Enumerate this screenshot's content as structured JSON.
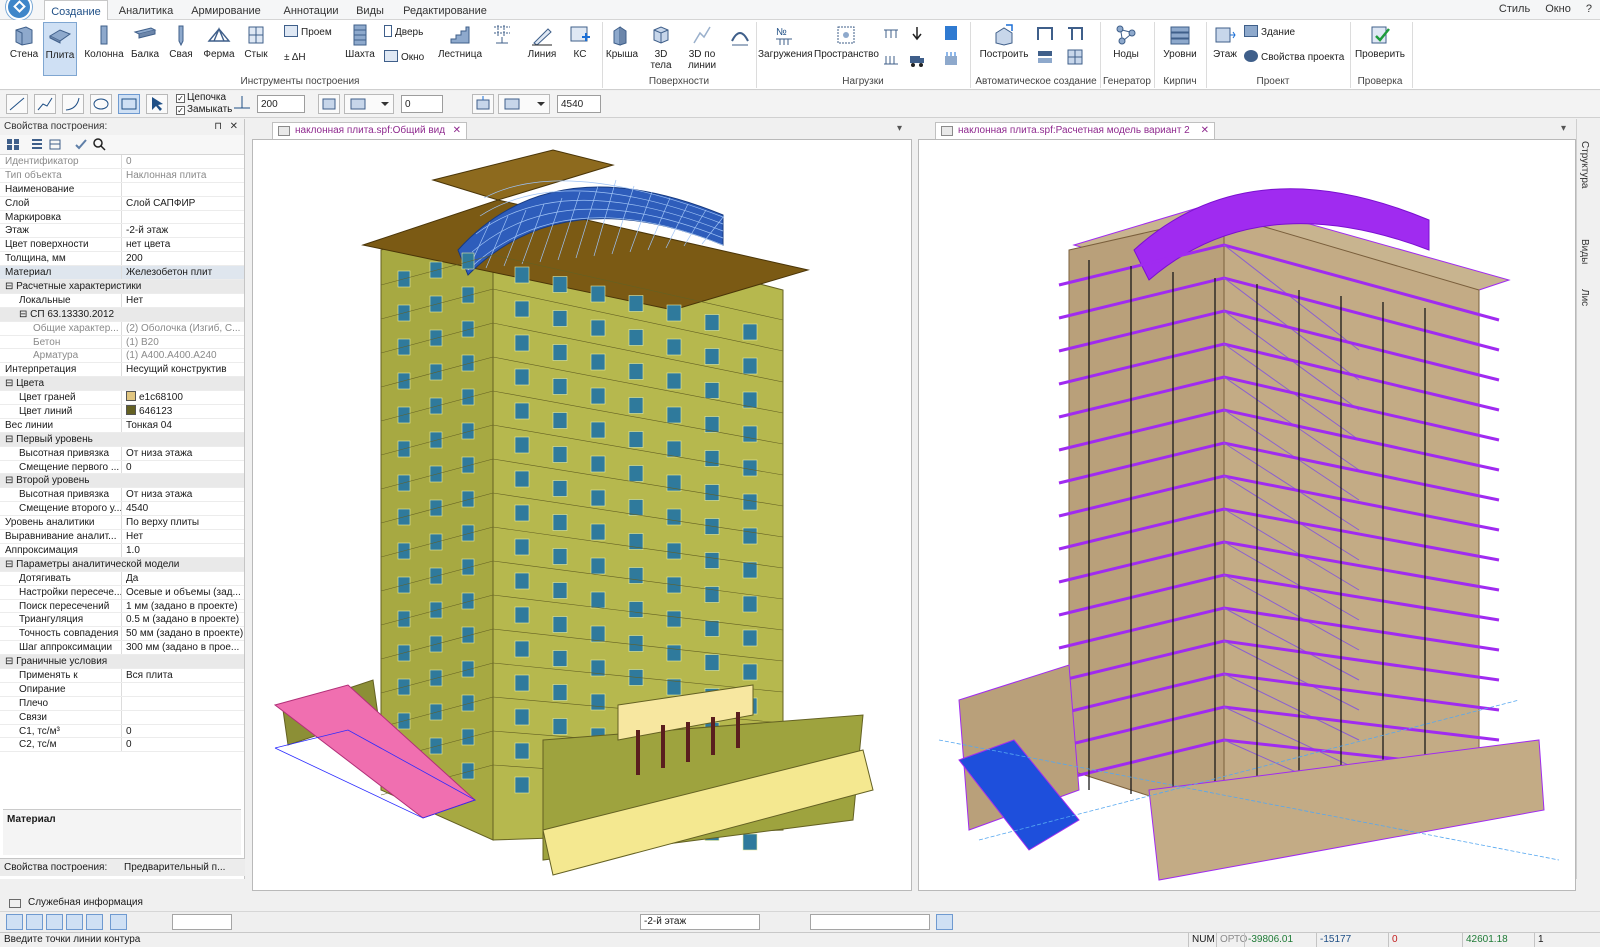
{
  "ribbon": {
    "tabs": [
      "Создание",
      "Аналитика",
      "Армирование",
      "Аннотации",
      "Виды",
      "Редактирование"
    ],
    "active_tab": "Создание",
    "right": {
      "style": "Стиль",
      "window": "Окно",
      "help": "?"
    },
    "build_tools": {
      "group_label": "Инструменты построения",
      "wall": "Стена",
      "slab": "Плита",
      "column": "Колонна",
      "beam": "Балка",
      "pile": "Свая",
      "truss": "Ферма",
      "joint": "Стык",
      "opening": "Проем",
      "delta_h": "± ΔН",
      "shaft": "Шахта",
      "door": "Дверь",
      "window": "Окно",
      "stair": "Лестница",
      "line": "Линия",
      "ks": "КС"
    },
    "surfaces": {
      "group_label": "Поверхности",
      "roof": "Крыша",
      "bodies3d": "3D тела",
      "by_line3d": "3D по линии"
    },
    "loads": {
      "group_label": "Нагрузки",
      "loadings": "Загружения",
      "spaces": "Пространство"
    },
    "auto": {
      "group_label": "Автоматическое создание",
      "build": "Построить"
    },
    "generator": {
      "group_label": "Генератор",
      "nodes": "Ноды"
    },
    "brick": {
      "group_label": "Кирпич",
      "levels": "Уровни"
    },
    "project": {
      "group_label": "Проект",
      "floor": "Этаж",
      "building": "Здание",
      "props": "Свойства проекта"
    },
    "check": {
      "group_label": "Проверка",
      "verify": "Проверить"
    }
  },
  "toolbar2": {
    "chain_label": "Цепочка",
    "close_label": "Замыкать",
    "thickness": "200",
    "offset": "0",
    "level": "4540"
  },
  "props_panel": {
    "title": "Свойства построения:",
    "rows": [
      {
        "k": "Идентификатор",
        "v": "0",
        "cls": "gray"
      },
      {
        "k": "Тип объекта",
        "v": "Наклонная плита",
        "cls": "gray"
      },
      {
        "k": "Наименование",
        "v": ""
      },
      {
        "k": "Слой",
        "v": "Слой САПФИР"
      },
      {
        "k": "Маркировка",
        "v": ""
      },
      {
        "k": "Этаж",
        "v": "-2-й этаж"
      },
      {
        "k": "Цвет поверхности",
        "v": "нет цвета"
      },
      {
        "k": "Толщина, мм",
        "v": "200"
      },
      {
        "k": "Материал",
        "v": "Железобетон плит",
        "cls": "hl"
      },
      {
        "k": "⊟ Расчетные характеристики",
        "v": "",
        "cls": "sec"
      },
      {
        "k": "Локальные",
        "v": "Нет",
        "cls": "lv1"
      },
      {
        "k": "⊟ СП 63.13330.2012",
        "v": "",
        "cls": "sec lv1"
      },
      {
        "k": "Общие характер...",
        "v": "(2) Оболочка (Изгиб, С...",
        "cls": "gray lv2"
      },
      {
        "k": "Бетон",
        "v": "(1) В20",
        "cls": "gray lv2"
      },
      {
        "k": "Арматура",
        "v": "(1) А400.А400.А240",
        "cls": "gray lv2"
      },
      {
        "k": "Интерпретация",
        "v": "Несущий конструктив"
      },
      {
        "k": "⊟ Цвета",
        "v": "",
        "cls": "sec"
      },
      {
        "k": "Цвет граней",
        "v": "e1c68100",
        "cls": "lv1",
        "swatch": "#e1c681"
      },
      {
        "k": "Цвет линий",
        "v": "646123",
        "cls": "lv1",
        "swatch": "#646123"
      },
      {
        "k": "Вес линии",
        "v": "Тонкая 04"
      },
      {
        "k": "⊟ Первый уровень",
        "v": "",
        "cls": "sec"
      },
      {
        "k": "Высотная привязка",
        "v": "От низа этажа",
        "cls": "lv1"
      },
      {
        "k": "Смещение первого ...",
        "v": "0",
        "cls": "lv1"
      },
      {
        "k": "⊟ Второй уровень",
        "v": "",
        "cls": "sec"
      },
      {
        "k": "Высотная привязка",
        "v": "От низа этажа",
        "cls": "lv1"
      },
      {
        "k": "Смещение второго у...",
        "v": "4540",
        "cls": "lv1"
      },
      {
        "k": "Уровень аналитики",
        "v": "По верху плиты"
      },
      {
        "k": "Выравнивание аналит...",
        "v": "Нет"
      },
      {
        "k": "Аппроксимация",
        "v": "1.0"
      },
      {
        "k": "⊟ Параметры аналитической модели",
        "v": "",
        "cls": "sec"
      },
      {
        "k": "Дотягивать",
        "v": "Да",
        "cls": "lv1"
      },
      {
        "k": "Настройки пересече...",
        "v": "Осевые и объемы (зад...",
        "cls": "lv1"
      },
      {
        "k": "Поиск пересечений",
        "v": "1 мм (задано в проекте)",
        "cls": "lv1"
      },
      {
        "k": "Триангуляция",
        "v": "0.5 м (задано в проекте)",
        "cls": "lv1"
      },
      {
        "k": "Точность совпадения",
        "v": "50 мм (задано в проекте)",
        "cls": "lv1"
      },
      {
        "k": "Шаг аппроксимации",
        "v": "300 мм (задано в прое...",
        "cls": "lv1"
      },
      {
        "k": "⊟ Граничные условия",
        "v": "",
        "cls": "sec"
      },
      {
        "k": "Применять к",
        "v": "Вся плита",
        "cls": "lv1"
      },
      {
        "k": "Опирание",
        "v": "",
        "cls": "lv1"
      },
      {
        "k": "Плечо",
        "v": "",
        "cls": "lv1"
      },
      {
        "k": "Связи",
        "v": "",
        "cls": "lv1"
      },
      {
        "k": "С1, тс/м³",
        "v": "0",
        "cls": "lv1"
      },
      {
        "k": "С2, тс/м",
        "v": "0",
        "cls": "lv1"
      }
    ],
    "description_title": "Материал",
    "bottom_tabs": [
      "Свойства построения:",
      "Предварительный п..."
    ]
  },
  "viewports": {
    "left_tab": "наклонная плита.spf:Общий вид",
    "right_tab": "наклонная плита.spf:Расчетная модель вариант 2"
  },
  "dock": [
    "Структура",
    "Виды",
    "Лис"
  ],
  "service_info": "Служебная информация",
  "bottom_toolbar": {
    "floor": "-2-й этаж"
  },
  "statusbar": {
    "message": "Введите точки линии контура",
    "num": "NUM",
    "orto": "ОРТО",
    "x": "-39806.01",
    "y": "-15177",
    "z": "0",
    "d": "42601.18",
    "n": "1"
  },
  "colors": {
    "building_face": "#b6b84e",
    "building_dark": "#8f9134",
    "roof": "#7b5a14",
    "dome": "#2e5dbb",
    "slab_pink": "#f06fb0",
    "podium": "#f4e890",
    "analytic_magenta": "#a02bf0",
    "mesh": "#b9a07a"
  }
}
